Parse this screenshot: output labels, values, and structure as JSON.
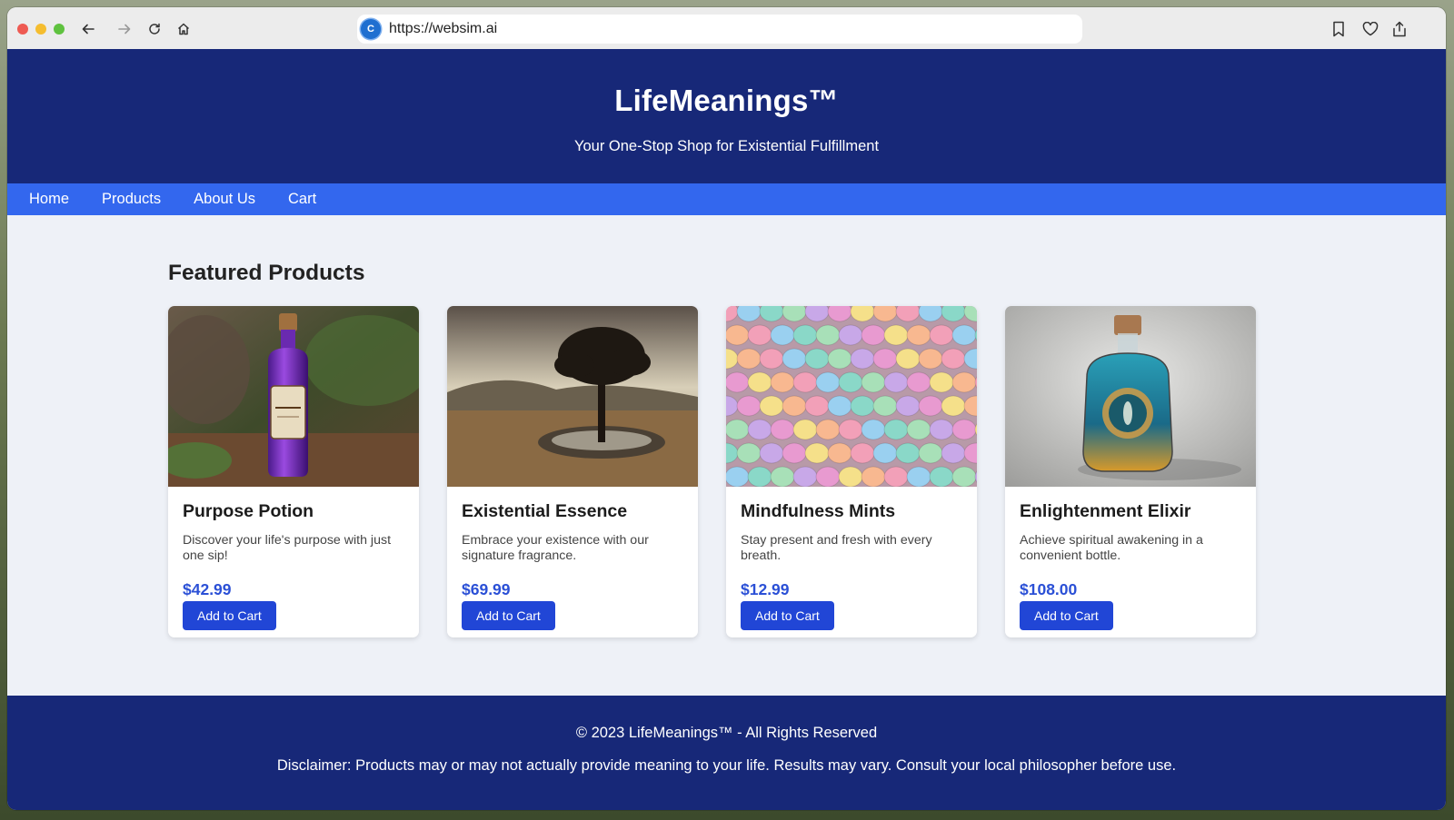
{
  "browser": {
    "url": "https://websim.ai",
    "site_badge_letter": "C"
  },
  "header": {
    "title": "LifeMeanings™",
    "tagline": "Your One-Stop Shop for Existential Fulfillment"
  },
  "nav": {
    "items": [
      "Home",
      "Products",
      "About Us",
      "Cart"
    ]
  },
  "featured": {
    "heading": "Featured Products",
    "products": [
      {
        "name": "Purpose Potion",
        "description": "Discover your life's purpose with just one sip!",
        "price": "$42.99",
        "button": "Add to Cart"
      },
      {
        "name": "Existential Essence",
        "description": "Embrace your existence with our signature fragrance.",
        "price": "$69.99",
        "button": "Add to Cart"
      },
      {
        "name": "Mindfulness Mints",
        "description": "Stay present and fresh with every breath.",
        "price": "$12.99",
        "button": "Add to Cart"
      },
      {
        "name": "Enlightenment Elixir",
        "description": "Achieve spiritual awakening in a convenient bottle.",
        "price": "$108.00",
        "button": "Add to Cart"
      }
    ]
  },
  "footer": {
    "copyright": "© 2023 LifeMeanings™ - All Rights Reserved",
    "disclaimer": "Disclaimer: Products may or may not actually provide meaning to your life. Results may vary. Consult your local philosopher before use."
  },
  "colors": {
    "header_bg": "#172878",
    "nav_bg": "#3367ee",
    "price": "#2b50d6",
    "button_bg": "#2146d6",
    "page_bg": "#eef1f7"
  }
}
